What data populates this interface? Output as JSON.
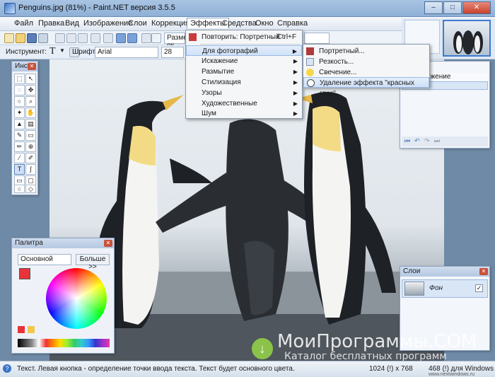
{
  "window": {
    "title": "Penguins.jpg (81%) - Paint.NET версия 3.5.5"
  },
  "menubar": {
    "items": [
      "Файл",
      "Правка",
      "Вид",
      "Изображение",
      "Слои",
      "Коррекция",
      "Эффекты",
      "Средства",
      "Окно",
      "Справка"
    ]
  },
  "toolbar": {
    "zoom_label": "Размер ок",
    "tool_label": "Инструмент:",
    "font_label": "Шрифт:",
    "font_value": "Arial",
    "size_value": "28"
  },
  "effects_menu": {
    "repeat": "Повторить: Портретный",
    "repeat_shortcut": "Ctrl+F",
    "items": [
      "Для фотографий",
      "Искажение",
      "Размытие",
      "Стилизация",
      "Узоры",
      "Художественные",
      "Шум"
    ]
  },
  "photo_submenu": {
    "items": [
      "Портретный...",
      "Резкость...",
      "Свечение...",
      "Удаление эффекта \"красных глаз\"..."
    ]
  },
  "tools_panel": {
    "title": "Инс..."
  },
  "history_panel": {
    "item1": "ь изображение",
    "item2": "ный"
  },
  "palette_panel": {
    "title": "Палитра",
    "mode": "Основной",
    "more": "Больше >>"
  },
  "layers_panel": {
    "title": "Слои",
    "layer_name": "Фон"
  },
  "status": {
    "text": "Текст. Левая кнопка - определение точки ввода текста. Текст будет основного цвета.",
    "size": "1024 (!) x 768",
    "coords": "468 (!) для Windows"
  },
  "watermark": {
    "line1": "МоиПрограммы.COM",
    "line2": "Каталог бесплатных программ",
    "site": "www.nextwindows.ru"
  },
  "colors": {
    "primary": "#e8333a",
    "secondary": "#ffffff"
  }
}
